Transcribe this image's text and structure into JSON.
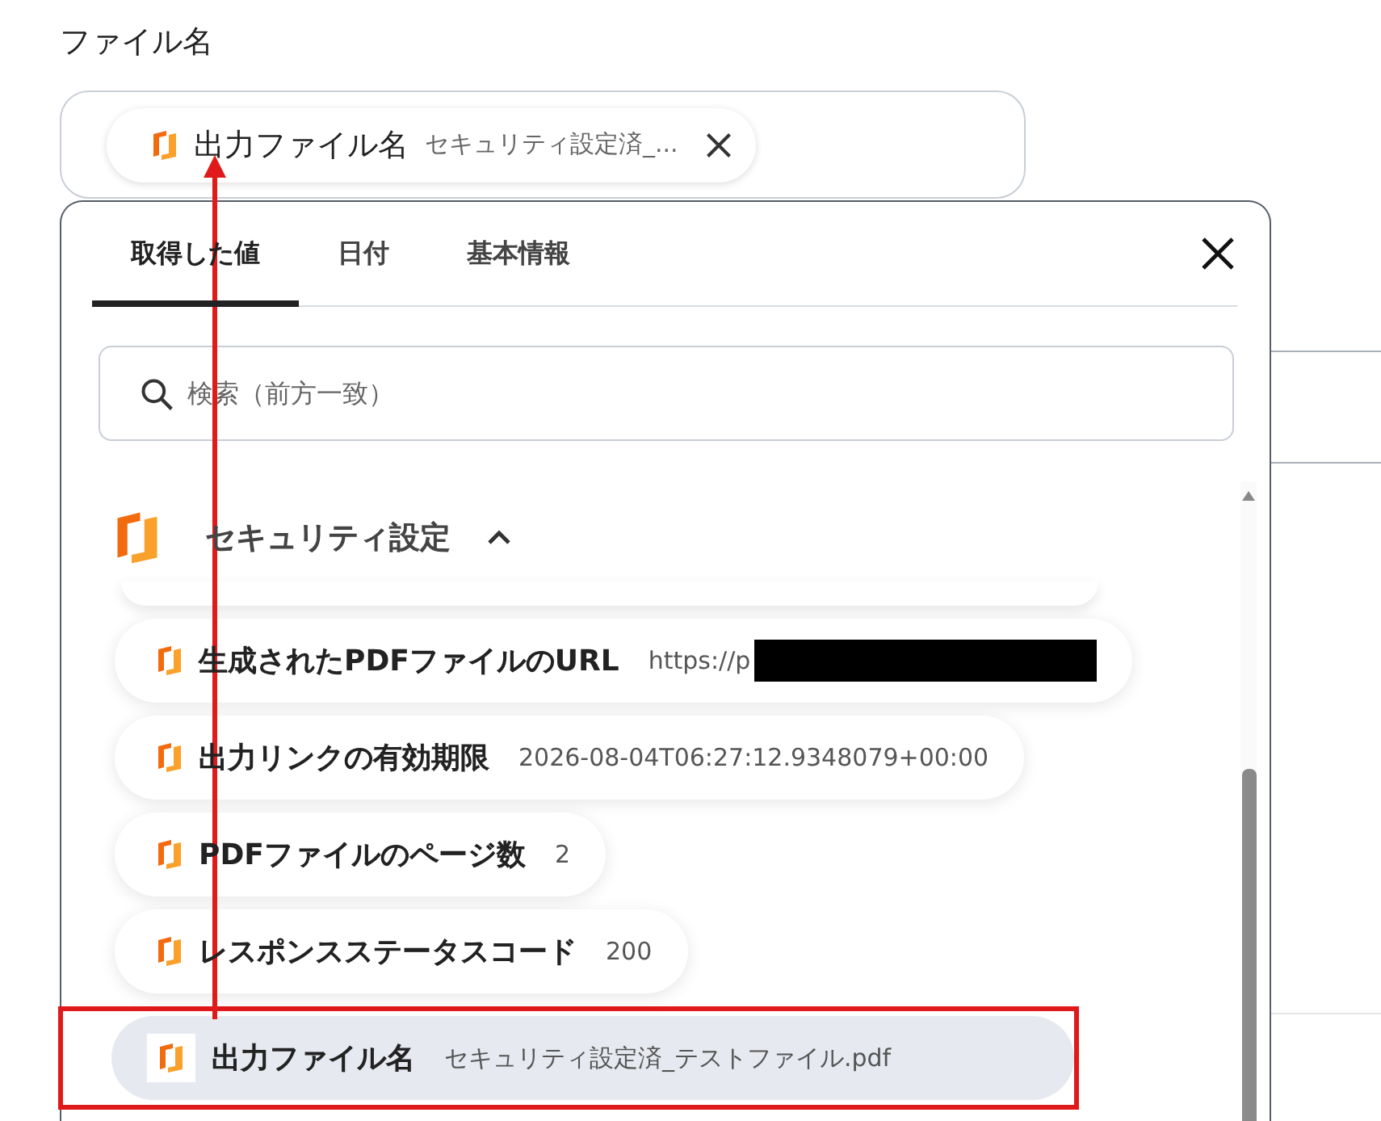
{
  "field": {
    "label": "ファイル名",
    "chip": {
      "name": "出力ファイル名",
      "value": "セキュリティ設定済_..."
    }
  },
  "panel": {
    "tabs": [
      {
        "label": "取得した値",
        "selected": true
      },
      {
        "label": "日付",
        "selected": false
      },
      {
        "label": "基本情報",
        "selected": false
      }
    ],
    "search": {
      "placeholder": "検索（前方一致）"
    },
    "group": {
      "title": "セキュリティ設定",
      "expanded": true
    },
    "items": [
      {
        "name": "生成されたPDFファイルのURL",
        "value": "https://p",
        "redacted": true,
        "highlighted": false
      },
      {
        "name": "出力リンクの有効期限",
        "value": "2026-08-04T06:27:12.9348079+00:00",
        "redacted": false,
        "highlighted": false
      },
      {
        "name": "PDFファイルのページ数",
        "value": "2",
        "redacted": false,
        "highlighted": false
      },
      {
        "name": "レスポンスステータスコード",
        "value": "200",
        "redacted": false,
        "highlighted": false
      },
      {
        "name": "出力ファイル名",
        "value": "セキュリティ設定済_テストファイル.pdf",
        "redacted": false,
        "highlighted": true
      }
    ]
  }
}
